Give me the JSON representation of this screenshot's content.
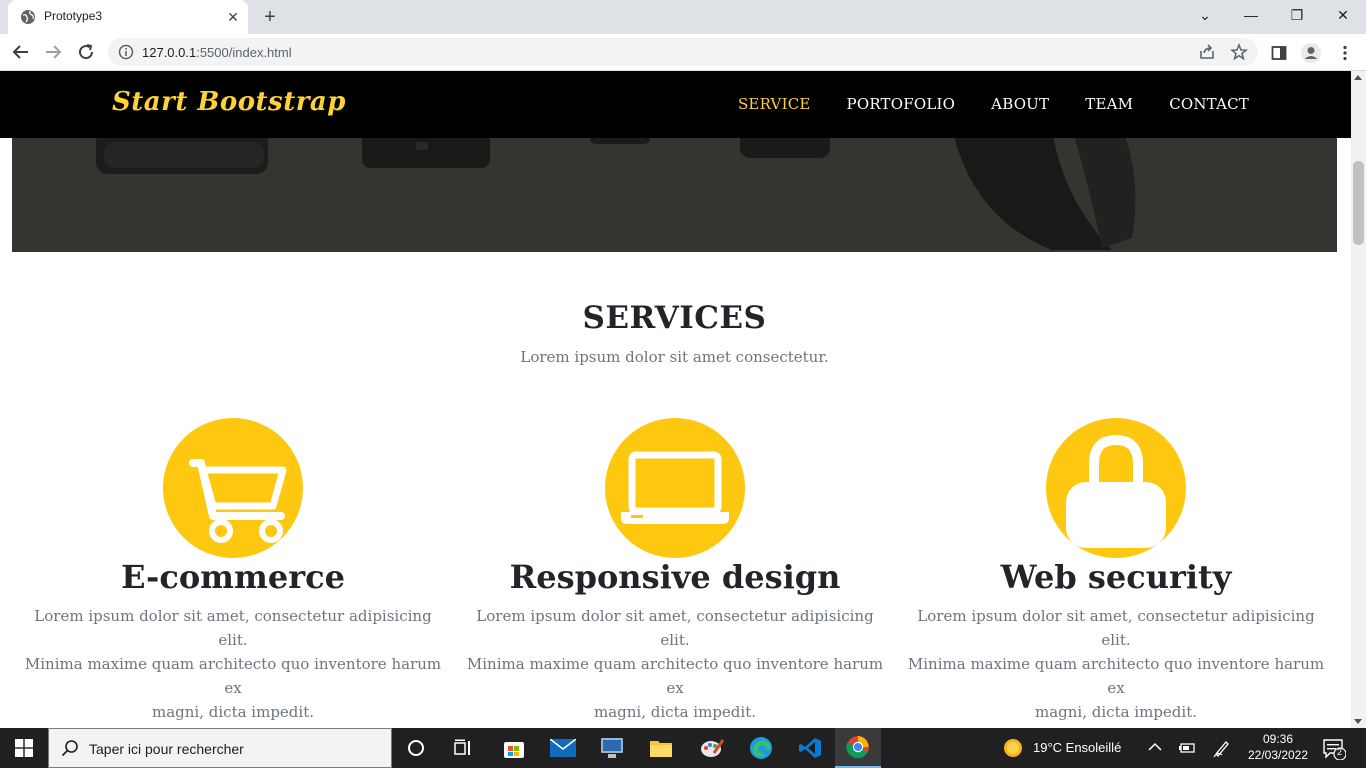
{
  "browser": {
    "tab_title": "Prototype3",
    "url_host": "127.0.0.1",
    "url_rest": ":5500/index.html"
  },
  "site": {
    "brand": "Start Bootstrap",
    "nav": [
      {
        "label": "SERVICE",
        "active": true
      },
      {
        "label": "PORTOFOLIO",
        "active": false
      },
      {
        "label": "ABOUT",
        "active": false
      },
      {
        "label": "TEAM",
        "active": false
      },
      {
        "label": "CONTACT",
        "active": false
      }
    ]
  },
  "services": {
    "title": "SERVICES",
    "subtitle": "Lorem ipsum dolor sit amet consectetur.",
    "items": [
      {
        "icon": "shopping-cart-icon",
        "title": "E-commerce",
        "line1": "Lorem ipsum dolor sit amet, consectetur adipisicing elit.",
        "line2": "Minima maxime quam architecto quo inventore harum ex",
        "line3": "magni, dicta impedit."
      },
      {
        "icon": "laptop-icon",
        "title": "Responsive design",
        "line1": "Lorem ipsum dolor sit amet, consectetur adipisicing elit.",
        "line2": "Minima maxime quam architecto quo inventore harum ex",
        "line3": "magni, dicta impedit."
      },
      {
        "icon": "lock-icon",
        "title": "Web security",
        "line1": "Lorem ipsum dolor sit amet, consectetur adipisicing elit.",
        "line2": "Minima maxime quam architecto quo inventore harum ex",
        "line3": "magni, dicta impedit."
      }
    ]
  },
  "taskbar": {
    "search_placeholder": "Taper ici pour rechercher",
    "weather": "19°C  Ensoleillé",
    "time": "09:36",
    "date": "22/03/2022",
    "notifications": "2"
  },
  "colors": {
    "accent": "#fed136",
    "icon_circle": "#fec810",
    "nav_bg": "#000000"
  }
}
